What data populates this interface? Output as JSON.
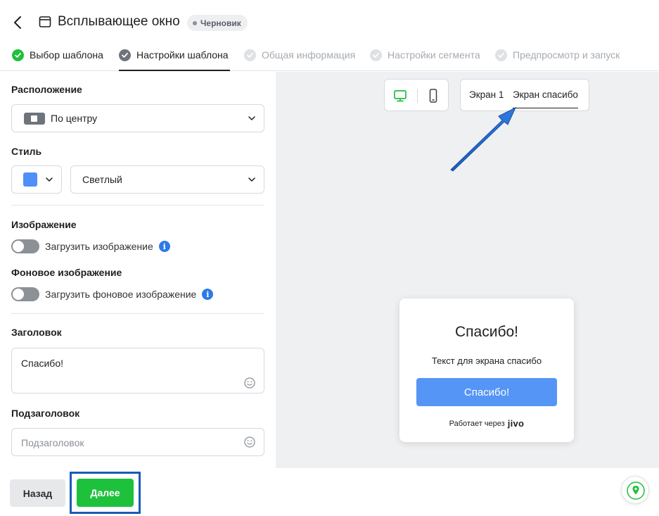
{
  "header": {
    "title": "Всплывающее окно",
    "status_badge": "Черновик"
  },
  "steps": [
    {
      "label": "Выбор шаблона",
      "state": "done"
    },
    {
      "label": "Настройки шаблона",
      "state": "current"
    },
    {
      "label": "Общая информация",
      "state": "pending"
    },
    {
      "label": "Настройки сегмента",
      "state": "pending"
    },
    {
      "label": "Предпросмотр и запуск",
      "state": "pending"
    }
  ],
  "settings": {
    "position_label": "Расположение",
    "position_value": "По центру",
    "style_label": "Стиль",
    "style_color": "#4f8ff7",
    "style_value": "Светлый",
    "image_label": "Изображение",
    "image_toggle_label": "Загрузить изображение",
    "image_toggle_on": false,
    "bg_image_label": "Фоновое изображение",
    "bg_image_toggle_label": "Загрузить фоновое изображение",
    "bg_image_toggle_on": false,
    "heading_label": "Заголовок",
    "heading_value": "Спасибо!",
    "subheading_label": "Подзаголовок",
    "subheading_placeholder": "Подзаголовок"
  },
  "preview": {
    "device_selected": "desktop",
    "screen_tabs": [
      "Экран 1",
      "Экран спасибо"
    ],
    "active_screen_tab": "Экран спасибо",
    "card": {
      "title": "Спасибо!",
      "text": "Текст для экрана спасибо",
      "button": "Спасибо!",
      "powered_by": "Работает через",
      "brand": "jivo"
    }
  },
  "footer": {
    "back_label": "Назад",
    "next_label": "Далее"
  },
  "colors": {
    "accent_green": "#1ec13c",
    "preview_button": "#5595f6",
    "annotation_blue": "#1a5bb5"
  }
}
